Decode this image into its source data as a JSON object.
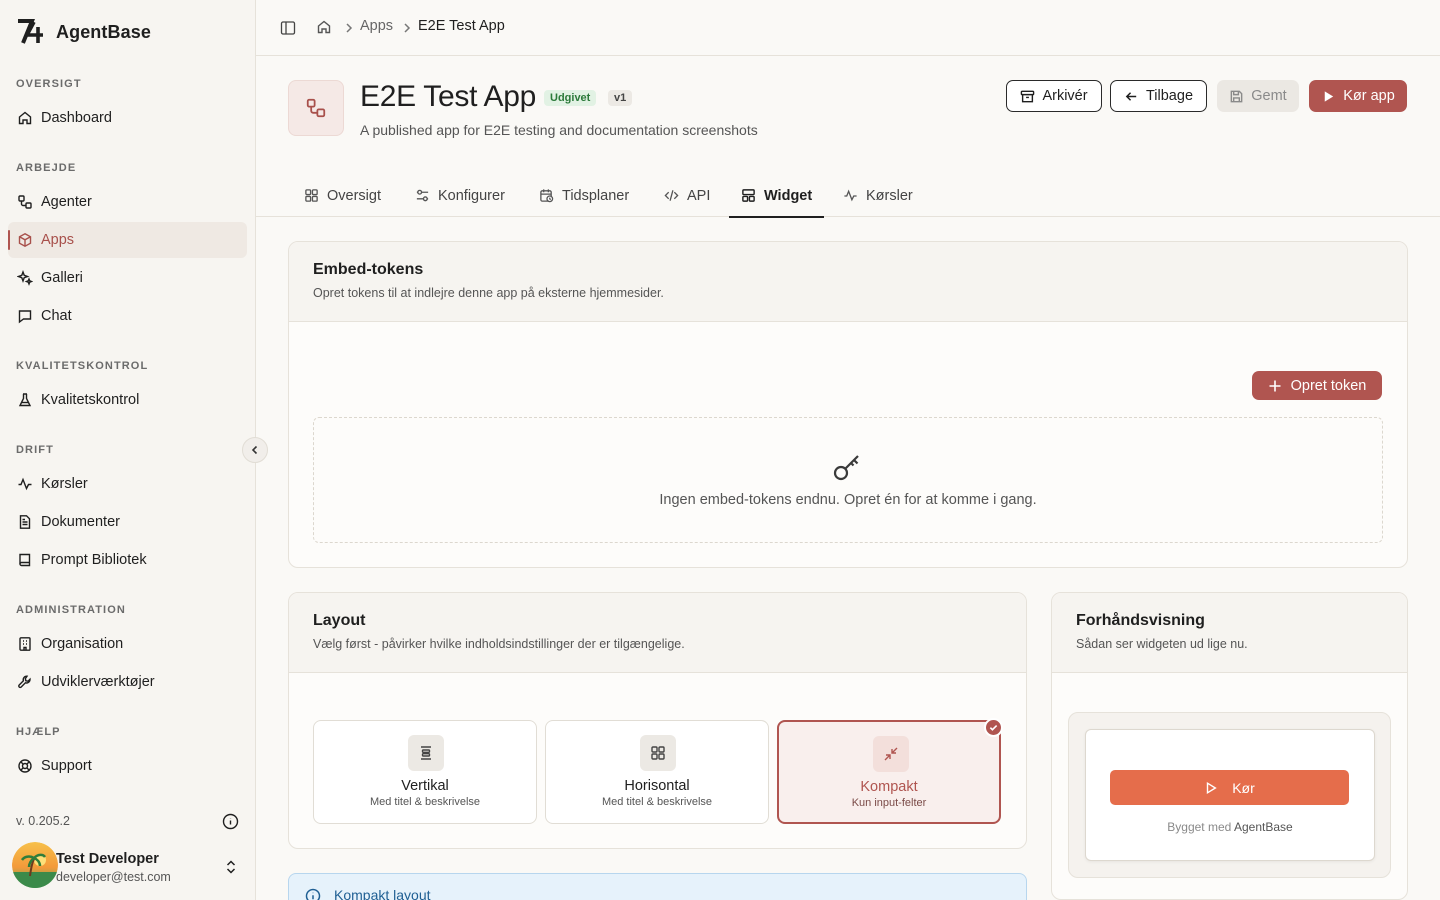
{
  "brand": {
    "name": "AgentBase"
  },
  "sidebar": {
    "sections": [
      {
        "label": "OVERSIGT",
        "items": [
          {
            "label": "Dashboard",
            "icon": "home-icon"
          }
        ]
      },
      {
        "label": "ARBEJDE",
        "items": [
          {
            "label": "Agenter",
            "icon": "workflow-icon"
          },
          {
            "label": "Apps",
            "icon": "box-icon",
            "active": true
          },
          {
            "label": "Galleri",
            "icon": "sparkles-icon"
          },
          {
            "label": "Chat",
            "icon": "chat-icon"
          }
        ]
      },
      {
        "label": "KVALITETSKONTROL",
        "items": [
          {
            "label": "Kvalitetskontrol",
            "icon": "flask-icon"
          }
        ]
      },
      {
        "label": "DRIFT",
        "items": [
          {
            "label": "Kørsler",
            "icon": "activity-icon"
          },
          {
            "label": "Dokumenter",
            "icon": "document-icon"
          },
          {
            "label": "Prompt Bibliotek",
            "icon": "book-icon"
          }
        ]
      },
      {
        "label": "ADMINISTRATION",
        "items": [
          {
            "label": "Organisation",
            "icon": "building-icon"
          },
          {
            "label": "Udviklerværktøjer",
            "icon": "wrench-icon"
          }
        ]
      },
      {
        "label": "HJÆLP",
        "items": [
          {
            "label": "Support",
            "icon": "lifebuoy-icon"
          }
        ]
      }
    ],
    "version": "v. 0.205.2",
    "user": {
      "name": "Test Developer",
      "email": "developer@test.com"
    }
  },
  "breadcrumb": {
    "apps": "Apps",
    "current": "E2E Test App"
  },
  "app": {
    "title": "E2E Test App",
    "status": "Udgivet",
    "version": "v1",
    "description": "A published app for E2E testing and documentation screenshots"
  },
  "actions": {
    "archive": "Arkivér",
    "back": "Tilbage",
    "saved": "Gemt",
    "run": "Kør app"
  },
  "tabs": [
    {
      "label": "Oversigt",
      "icon": "grid-icon"
    },
    {
      "label": "Konfigurer",
      "icon": "sliders-icon"
    },
    {
      "label": "Tidsplaner",
      "icon": "calendar-clock-icon"
    },
    {
      "label": "API",
      "icon": "code-icon"
    },
    {
      "label": "Widget",
      "icon": "layout-icon",
      "active": true
    },
    {
      "label": "Kørsler",
      "icon": "activity-icon"
    }
  ],
  "embed": {
    "title": "Embed-tokens",
    "subtitle": "Opret tokens til at indlejre denne app på eksterne hjemmesider.",
    "create_label": "Opret token",
    "empty_text": "Ingen embed-tokens endnu. Opret én for at komme i gang."
  },
  "layout": {
    "title": "Layout",
    "subtitle": "Vælg først - påvirker hvilke indholdsindstillinger der er tilgængelige.",
    "options": [
      {
        "title": "Vertikal",
        "sub": "Med titel & beskrivelse",
        "icon": "align-vertical-icon"
      },
      {
        "title": "Horisontal",
        "sub": "Med titel & beskrivelse",
        "icon": "grid-icon"
      },
      {
        "title": "Kompakt",
        "sub": "Kun input-felter",
        "icon": "minimize-icon",
        "selected": true
      }
    ]
  },
  "preview": {
    "title": "Forhåndsvisning",
    "subtitle": "Sådan ser widgeten ud lige nu.",
    "run_label": "Kør",
    "built_prefix": "Bygget med",
    "built_brand": "AgentBase"
  },
  "info": {
    "title": "Kompakt layout"
  },
  "colors": {
    "accent": "#b05550",
    "preview_button": "#e56d4b",
    "published_bg": "#e2f2e4",
    "info_bg": "#e6f2fb"
  }
}
